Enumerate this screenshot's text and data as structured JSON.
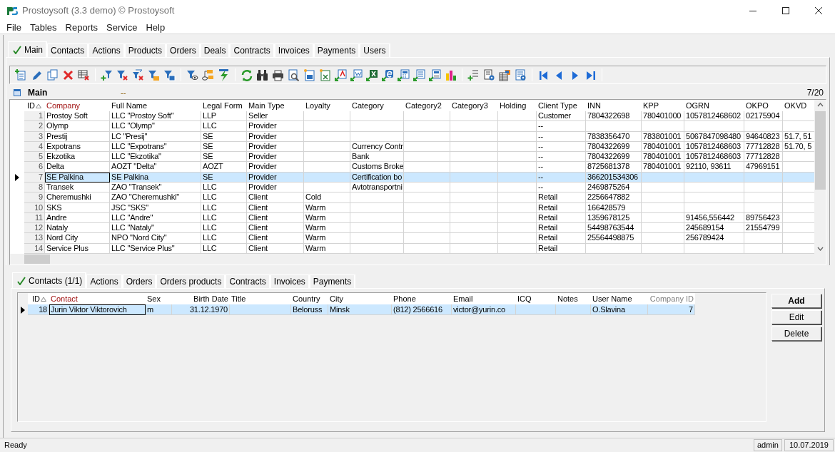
{
  "window": {
    "title": "Prostoysoft (3.3 demo) © Prostoysoft"
  },
  "menu": [
    "File",
    "Tables",
    "Reports",
    "Service",
    "Help"
  ],
  "tabs": [
    {
      "label": "Main",
      "selected": true
    },
    {
      "label": "Contacts",
      "selected": false
    },
    {
      "label": "Actions",
      "selected": false
    },
    {
      "label": "Products",
      "selected": false
    },
    {
      "label": "Orders",
      "selected": false
    },
    {
      "label": "Deals",
      "selected": false
    },
    {
      "label": "Contracts",
      "selected": false
    },
    {
      "label": "Invoices",
      "selected": false
    },
    {
      "label": "Payments",
      "selected": false
    },
    {
      "label": "Users",
      "selected": false
    }
  ],
  "main_grid": {
    "title": "Main",
    "filter": "--",
    "counter": "7/20",
    "columns": [
      {
        "label": "ID",
        "kind": "sorted"
      },
      {
        "label": "Company",
        "kind": "key"
      },
      {
        "label": "Full Name",
        "kind": "normal"
      },
      {
        "label": "Legal Form",
        "kind": "normal"
      },
      {
        "label": "Main Type",
        "kind": "normal"
      },
      {
        "label": "Loyalty",
        "kind": "normal"
      },
      {
        "label": "Category",
        "kind": "normal"
      },
      {
        "label": "Category2",
        "kind": "normal"
      },
      {
        "label": "Category3",
        "kind": "normal"
      },
      {
        "label": "Holding",
        "kind": "normal"
      },
      {
        "label": "Client Type",
        "kind": "normal"
      },
      {
        "label": "INN",
        "kind": "normal"
      },
      {
        "label": "KPP",
        "kind": "normal"
      },
      {
        "label": "OGRN",
        "kind": "normal"
      },
      {
        "label": "OKPO",
        "kind": "normal"
      },
      {
        "label": "OKVD",
        "kind": "normal"
      }
    ],
    "rows": [
      {
        "selected": false,
        "cells": [
          "1",
          "Prostoy Soft",
          "LLC \"Prostoy Soft\"",
          "LLP",
          "Seller",
          null,
          null,
          null,
          null,
          null,
          "Customer",
          "7804322698",
          "780401000",
          "1057812468602",
          "02175904",
          null
        ]
      },
      {
        "selected": false,
        "cells": [
          "2",
          "Olymp",
          "LLC \"Olymp\"",
          "LLC",
          "Provider",
          null,
          null,
          null,
          null,
          null,
          "--",
          null,
          null,
          null,
          null,
          null
        ]
      },
      {
        "selected": false,
        "cells": [
          "3",
          "Prestij",
          "LC \"Presij\"",
          "SE",
          "Provider",
          null,
          null,
          null,
          null,
          null,
          "--",
          "7838356470",
          "783801001",
          "5067847098480",
          "94640823",
          "51.7, 51"
        ]
      },
      {
        "selected": false,
        "cells": [
          "4",
          "Expotrans",
          "LLC \"Expotrans\"",
          "SE",
          "Provider",
          null,
          "Currency Contr",
          null,
          null,
          null,
          "--",
          "7804322699",
          "780401001",
          "1057812468603",
          "77712828",
          "51.70, 5"
        ]
      },
      {
        "selected": false,
        "cells": [
          "5",
          "Ekzotika",
          "LLC \"Ekzotika\"",
          "SE",
          "Provider",
          null,
          "Bank",
          null,
          null,
          null,
          "--",
          "7804322699",
          "780401001",
          "1057812468603",
          "77712828",
          null
        ]
      },
      {
        "selected": false,
        "cells": [
          "6",
          "Delta",
          "AOZT \"Delta\"",
          "AOZT",
          "Provider",
          null,
          "Customs Broke",
          null,
          null,
          null,
          "--",
          "8725681378",
          "780401001",
          "92110, 93611",
          "47969151",
          null
        ]
      },
      {
        "selected": true,
        "cells": [
          "7",
          "SE Palkina",
          "SE Palkina",
          "SE",
          "Provider",
          null,
          "Certification bo",
          null,
          null,
          null,
          "--",
          "366201534306",
          null,
          null,
          null,
          null
        ]
      },
      {
        "selected": false,
        "cells": [
          "8",
          "Transek",
          "ZAO \"Transek\"",
          "LLC",
          "Provider",
          null,
          "Avtotransportni",
          null,
          null,
          null,
          "--",
          "2469875264",
          null,
          null,
          null,
          null
        ]
      },
      {
        "selected": false,
        "cells": [
          "9",
          "Cheremushki",
          "ZAO \"Cheremushki\"",
          "LLC",
          "Client",
          "Cold",
          null,
          null,
          null,
          null,
          "Retail",
          "2256647882",
          null,
          null,
          null,
          null
        ]
      },
      {
        "selected": false,
        "cells": [
          "10",
          "SKS",
          "JSC \"SKS\"",
          "LLC",
          "Client",
          "Warm",
          null,
          null,
          null,
          null,
          "Retail",
          "166428579",
          null,
          null,
          null,
          null
        ]
      },
      {
        "selected": false,
        "cells": [
          "11",
          "Andre",
          "LLC \"Andre\"",
          "LLC",
          "Client",
          "Warm",
          null,
          null,
          null,
          null,
          "Retail",
          "1359678125",
          null,
          "91456,556442",
          "89756423",
          null
        ]
      },
      {
        "selected": false,
        "cells": [
          "12",
          "Nataly",
          "LLC \"Nataly\"",
          "LLC",
          "Client",
          "Warm",
          null,
          null,
          null,
          null,
          "Retail",
          "54498763544",
          null,
          "245689154",
          "21554799",
          null
        ]
      },
      {
        "selected": false,
        "cells": [
          "13",
          "Nord City",
          "NPO \"Nord City\"",
          "LLC",
          "Client",
          "Warm",
          null,
          null,
          null,
          null,
          "Retail",
          "25564498875",
          null,
          "256789424",
          null,
          null
        ]
      },
      {
        "selected": false,
        "cells": [
          "14",
          "Service Plus",
          "LLC \"Service Plus\"",
          "LLC",
          "Client",
          "Warm",
          null,
          null,
          null,
          null,
          "Retail",
          null,
          null,
          null,
          null,
          null
        ]
      }
    ]
  },
  "detail_tabs": [
    {
      "label": "Contacts (1/1)",
      "selected": true
    },
    {
      "label": "Actions",
      "selected": false
    },
    {
      "label": "Orders",
      "selected": false
    },
    {
      "label": "Orders products",
      "selected": false
    },
    {
      "label": "Contracts",
      "selected": false
    },
    {
      "label": "Invoices",
      "selected": false
    },
    {
      "label": "Payments",
      "selected": false
    }
  ],
  "detail_grid": {
    "columns": [
      {
        "label": "ID",
        "kind": "sorted"
      },
      {
        "label": "Contact",
        "kind": "key"
      },
      {
        "label": "Sex",
        "kind": "normal"
      },
      {
        "label": "Birth Date",
        "kind": "right"
      },
      {
        "label": "Title",
        "kind": "normal"
      },
      {
        "label": "Country",
        "kind": "normal"
      },
      {
        "label": "City",
        "kind": "normal"
      },
      {
        "label": "Phone",
        "kind": "normal"
      },
      {
        "label": "Email",
        "kind": "normal"
      },
      {
        "label": "ICQ",
        "kind": "normal"
      },
      {
        "label": "Notes",
        "kind": "normal"
      },
      {
        "label": "User Name",
        "kind": "normal"
      },
      {
        "label": "Company ID",
        "kind": "muted"
      }
    ],
    "rows": [
      {
        "selected": true,
        "cells": [
          "18",
          "Jurin Viktor Viktorovich",
          "m",
          "31.12.1970",
          null,
          "Beloruss",
          "Minsk",
          "(812) 2566616",
          "victor@yurin.co",
          null,
          null,
          "O.Slavina",
          "7"
        ]
      }
    ]
  },
  "detail_buttons": [
    {
      "label": "Add",
      "default": true
    },
    {
      "label": "Edit",
      "default": false
    },
    {
      "label": "Delete",
      "default": false
    }
  ],
  "status_bar": {
    "message": "Ready",
    "user": "admin",
    "date": "10.07.2019"
  }
}
